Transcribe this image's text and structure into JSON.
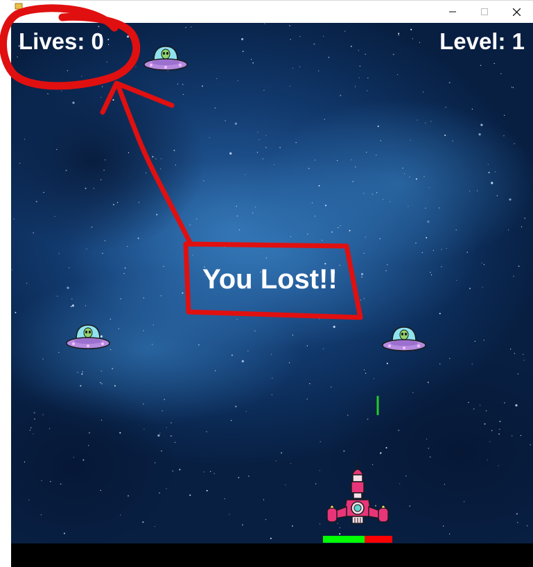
{
  "window": {
    "minimize_glyph": "–",
    "maximize_glyph": "☐",
    "close_glyph": "✕"
  },
  "hud": {
    "lives_text": "Lives: 0",
    "level_text": "Level: 1"
  },
  "message": {
    "text": "You Lost!!"
  },
  "player": {
    "health_fraction": 0.6
  },
  "enemies": [
    {
      "icon": "alien-ufo-icon"
    },
    {
      "icon": "alien-ufo-icon"
    },
    {
      "icon": "alien-ufo-icon"
    }
  ],
  "colors": {
    "health_good": "#00ff00",
    "health_bad": "#ff0000",
    "laser": "#22cc22",
    "annotation": "#e01010",
    "ufo_dome": "#8fe3ee",
    "ufo_saucer": "#b58be0",
    "alien": "#8fd36a",
    "ship": "#e8357a"
  }
}
